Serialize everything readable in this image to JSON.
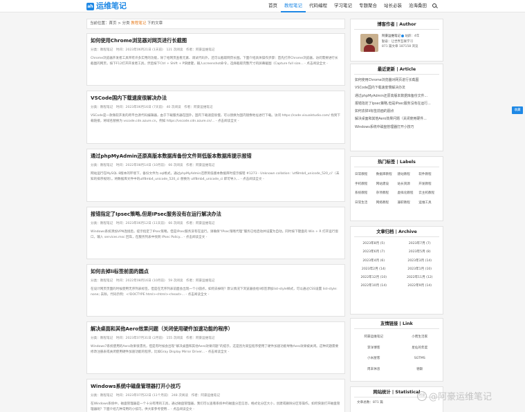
{
  "header": {
    "logo_icon": "ah",
    "site_name": "运维笔记",
    "nav": [
      "首页",
      "教程笔记",
      "代码编程",
      "学习笔记",
      "专题聚合",
      "站长必装",
      "沧海桑田"
    ]
  },
  "breadcrumb": {
    "prefix": "当前位置：首页",
    "sep1": " > ",
    "mid": "分类",
    "category": "教程笔记",
    "suffix": "下的文章"
  },
  "posts": [
    {
      "title": "如何使用Chrome浏览器对网页进行长截图",
      "meta": "分类：教程笔记　时间：2023年06月21日 (1天前)　121 次阅读　作者：阿豪运维笔记",
      "excerpt": "Chrome浏览器开发者工具带有许多实用的功能，除了给网页查看元素、调试代码外，还可以截取网页长图。下面介绍具体操作步骤：首先打开Chrome浏览器，访问需要进行长截图的网页，按下F12打开开发者工具，然后按下Ctrl + Shift + P快捷键，输入screenshot命令，选择截取完整尺寸的屏幕截图（Capture full size... - 点击阅读全文 -"
    },
    {
      "title": "VSCode国内下载速度很解决办法",
      "meta": "分类：教程笔记　时间：2023年06月16日 (7天前)　40 次阅读　作者：阿豪运维笔记",
      "excerpt": "VSCode是一款微软开发的跨平台源代码编辑器，由于下载服务器在国外，国内下载速度很慢，可以替换为国内镜像地址进行下载。访问 https://code.visualstudio.com/ 找到下载链接，将域名替换为 vscode.cdn.azure.cn，例如 https://vscode.cdn.azure.cn/... - 点击阅读全文 -"
    },
    {
      "title": "通过phpMyAdmin还原高版本数据库备份文件到低版本数据库提示报错",
      "meta": "分类：教程笔记　时间：2022年08月14日 (10月前)　66 次阅读　作者：阿豪运维笔记",
      "excerpt": "网站运行在MySQL 8版本的环境下，备份文件为.sql格式，通过phpMyAdmin还原到低版本数据库时提示报错 #1273 - Unknown collation: 'utf8mb4_unicode_520_ci'（未知的排序规则）。将数据库文件中的utf8mb4_unicode_520_ci 替换为 utf8mb4_unicode_ci 即可导入... - 点击阅读全文 -"
    },
    {
      "title": "报错指定了Ipsec策略,但是IPsec服务没有在运行解决办法",
      "meta": "分类：教程笔记　时间：2023年06月12日 (11天前)　66 次阅读　作者：阿豪运维笔记",
      "excerpt": "Windows系统添加VPN连接后，提示指定了IPsec策略，但是IPsec服务没有在运行。请确保“IPsec策略代理”服务已经启动并设置为自动。同时按下键盘的 Win + R 打开运行窗口，输入 services.msc 回车，在服务列表中找到 IPsec Policy... - 点击阅读全文 -"
    },
    {
      "title": "如何去掉li标签前面的圆点",
      "meta": "分类：教程笔记　时间：2022年08月16日 (10月前)　59 次阅读　作者：阿豪运维笔记",
      "excerpt": "在设计网页页面的时候使用无序列表标签，但是在无序列表前面会出现一个小圆点，如何去掉呢？默认情况下浏览器会给li标签添加list-style样式，可以通过CSS设置 list-style: none; 去除，代码示例：<!DOCTYPE html><html><head>... - 点击阅读全文 -"
    },
    {
      "title": "解决桌面和其他Aero效果问题（关闭使用硬件加速功能的程序）",
      "meta": "分类：教程笔记　时间：2023年07月31日 (2月前)　155 次阅读　作者：阿豪运维笔记",
      "excerpt": "Windows7系统使用的Aero效果很漂亮，但是有时候会出现“解决桌面和其他Aero效果问题”的提示，这是因为某些程序使用了硬件加速功能导致Aero效果被关闭。这种问题需要修改注册表或关闭使用硬件加速功能的程序，比如Gray Display Mirror Driver... - 点击阅读全文 -"
    },
    {
      "title": "Windows系统中磁盘管理器打开小技巧",
      "meta": "分类：教程笔记　时间：2023年07月22日 (11个月前)　248 次阅读　作者：阿豪运维笔记",
      "excerpt": "在Windows系统中，磁盘管理器是一个十分有用的工具，通过磁盘管理器，我们可以查看系统中的磁盘分区信息，格式化分区大小，创建或删除分区等操作。如何快速打开磁盘管理器呢？下面介绍几种常用的小技巧，供大家参考使用... - 点击阅读全文 -"
    }
  ],
  "author_widget": {
    "title": "博客作者 | Author",
    "name": "阿豪运维笔记",
    "since": "站龄：4年",
    "motto": "勤奋：让世界互联学习",
    "stats": "871 篇文章 187158 浏览"
  },
  "latest_widget": {
    "title": "最近更新 | Article",
    "items": [
      "如何使用Chrome浏览器对网页进行长截图",
      "VSCode国内下载速度慢解决办法",
      "通过phpMyAdmin还原高版本数据库备份文件...",
      "报错指定了Ipsec策略,但是IPsec服务没有在运行...",
      "如何去掉li标签前面的圆点",
      "解决桌面和其他Aero效果问题（关闭使用硬件...",
      "Windows系统中磁盘管理器打开小技巧"
    ]
  },
  "tags_widget": {
    "title": "热门标签 | Labels",
    "tags": [
      "日常教程",
      "数据库教程",
      "建站教程",
      "软件教程",
      "手机教程",
      "网站建设",
      "站长资源",
      "开发教程",
      "系统教程",
      "杂项教程",
      "虚拟化教程",
      "云主机教程",
      "日常生活",
      "网络教程",
      "兼职教程",
      "运维工具"
    ]
  },
  "archive_widget": {
    "title": "文章归档 | Archive",
    "items": [
      "2023年8月 (5)",
      "2023年7月 (7)",
      "2023年6月 (7)",
      "2023年5月 (8)",
      "2023年4月 (6)",
      "2023年3月 (14)",
      "2023年2月 (14)",
      "2023年1月 (10)",
      "2022年12月 (10)",
      "2022年11月 (12)",
      "2022年10月 (14)",
      "2022年9月 (14)"
    ]
  },
  "links_widget": {
    "title": "友情链接 | Link",
    "items": [
      "阿豪运维笔记",
      "小而生活家",
      "李洋博客",
      "星仙的年度",
      "小米屋客",
      "SGTMS",
      "周末休息",
      "德斯"
    ]
  },
  "stats_widget": {
    "title": "网站统计 | Statistical",
    "line": "文章总数：871 篇"
  },
  "float_button": "收藏",
  "watermark": {
    "icon": "阿豪",
    "text": "@阿豪运维笔记"
  },
  "colors": {
    "brand": "#1e88e5",
    "highlight": "#e67e22",
    "background": "#f5f5f5"
  }
}
